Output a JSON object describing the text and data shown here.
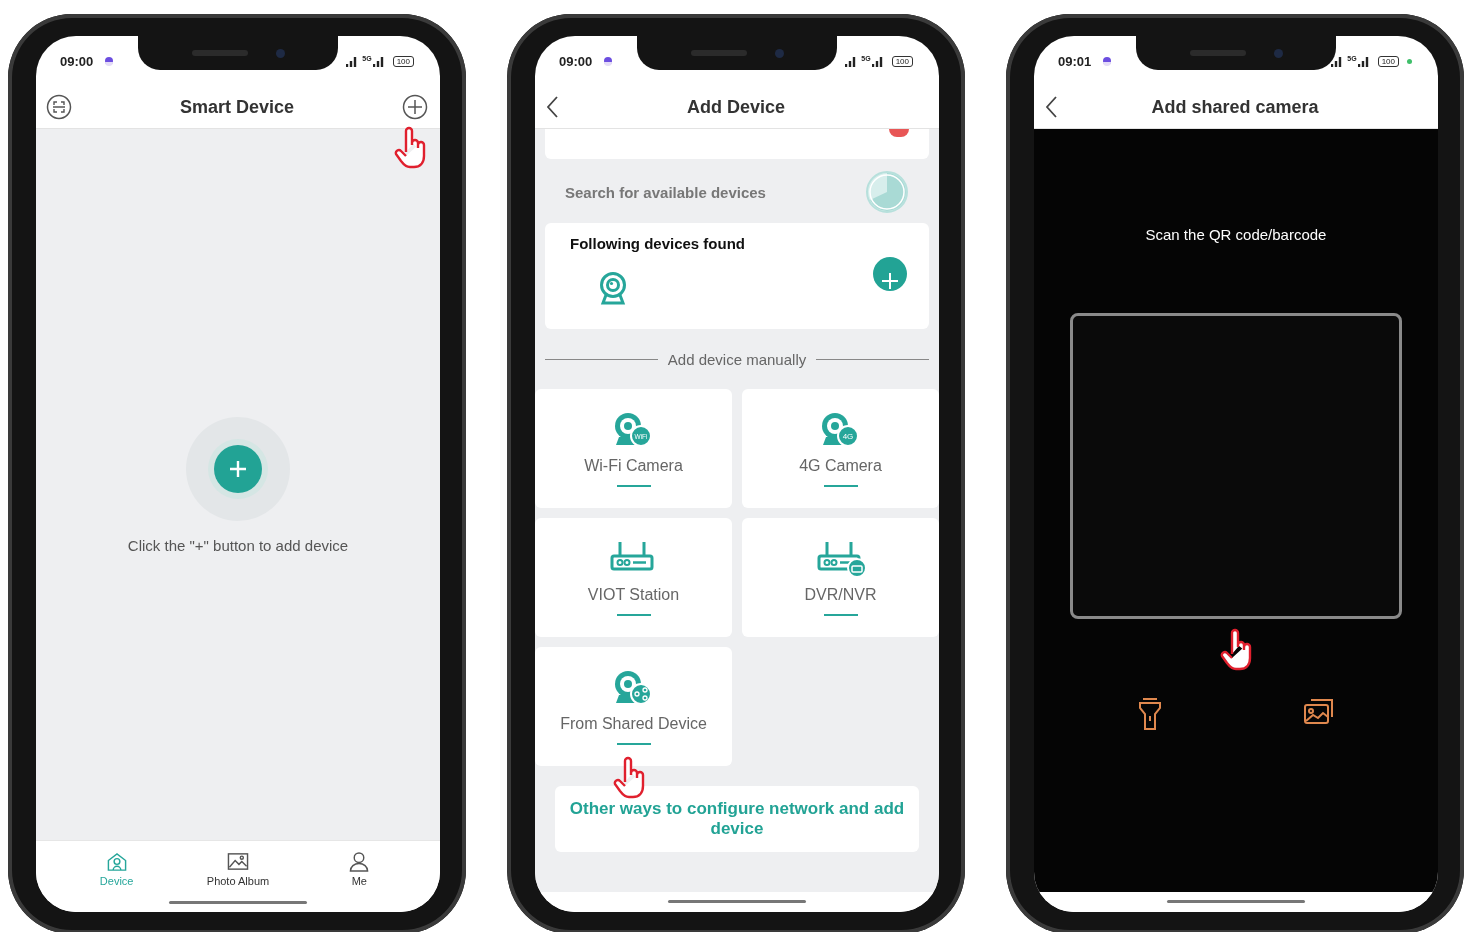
{
  "phones": [
    {
      "kind": "smart-device",
      "status_bar": {
        "time": "09:00",
        "network": "5G",
        "battery": "100",
        "indicator_dot": false
      },
      "header": {
        "title": "Smart Device"
      },
      "empty_state": {
        "message": "Click the \"+\" button to add device"
      },
      "tab_bar": [
        {
          "label": "Device",
          "selected": true
        },
        {
          "label": "Photo Album",
          "selected": false
        },
        {
          "label": "Me",
          "selected": false
        }
      ]
    },
    {
      "kind": "add-device",
      "status_bar": {
        "time": "09:00",
        "network": "5G",
        "battery": "100",
        "indicator_dot": false
      },
      "header": {
        "title": "Add Device"
      },
      "search": {
        "label": "Search for available devices"
      },
      "found": {
        "title": "Following devices found"
      },
      "divider_label": "Add device manually",
      "device_types": [
        {
          "label": "Wi-Fi Camera",
          "kind": "camera",
          "badge": "WiFi"
        },
        {
          "label": "4G Camera",
          "kind": "camera",
          "badge": "4G"
        },
        {
          "label": "VIOT Station",
          "kind": "station"
        },
        {
          "label": "DVR/NVR",
          "kind": "recorder"
        },
        {
          "label": "From Shared Device",
          "kind": "shared"
        }
      ],
      "other_ways_link": "Other ways to configure network and add device"
    },
    {
      "kind": "scan",
      "status_bar": {
        "time": "09:01",
        "network": "5G",
        "battery": "100",
        "indicator_dot": true
      },
      "header": {
        "title": "Add shared camera"
      },
      "scan": {
        "prompt": "Scan the QR code/barcode"
      }
    }
  ]
}
